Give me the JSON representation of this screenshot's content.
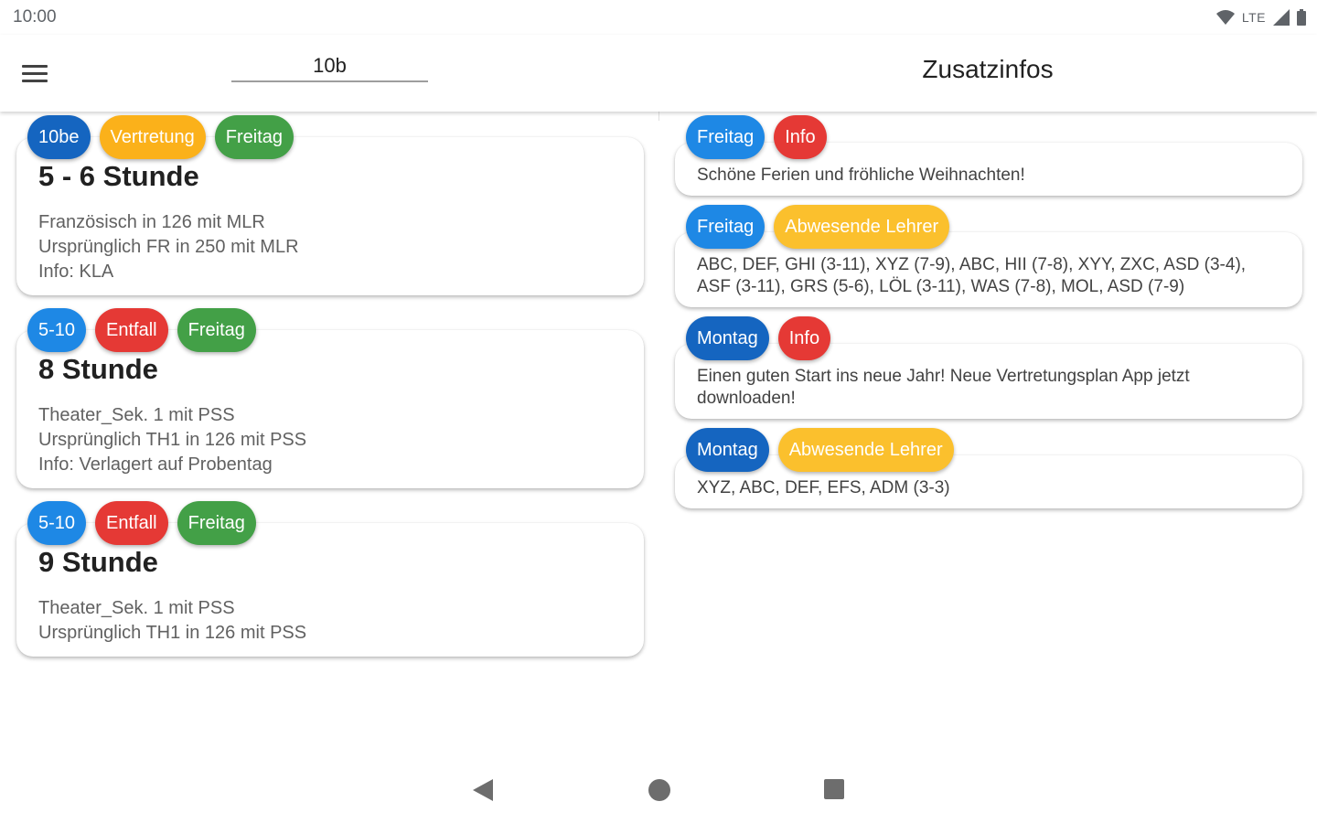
{
  "status_bar": {
    "time": "10:00",
    "network": "LTE"
  },
  "app_bar": {
    "menu_icon": "menu-icon",
    "class_field_value": "10b",
    "info_title": "Zusatzinfos"
  },
  "colors": {
    "blue": "#1e88e5",
    "dark_blue": "#1565c0",
    "orange": "#fbb11a",
    "yellow": "#fbc02d",
    "green": "#43a047",
    "red": "#e53935"
  },
  "lessons": [
    {
      "tags": [
        {
          "label": "10be",
          "color": "#1565c0"
        },
        {
          "label": "Vertretung",
          "color": "#fbb11a"
        },
        {
          "label": "Freitag",
          "color": "#43a047"
        }
      ],
      "title": "5 - 6 Stunde",
      "lines": [
        "Französisch in 126 mit MLR",
        "Ursprünglich FR in 250 mit MLR",
        "Info: KLA"
      ]
    },
    {
      "tags": [
        {
          "label": "5-10",
          "color": "#1e88e5"
        },
        {
          "label": "Entfall",
          "color": "#e53935"
        },
        {
          "label": "Freitag",
          "color": "#43a047"
        }
      ],
      "title": "8 Stunde",
      "lines": [
        "Theater_Sek. 1 mit PSS",
        "Ursprünglich TH1 in 126 mit PSS",
        "Info: Verlagert auf Probentag"
      ]
    },
    {
      "tags": [
        {
          "label": "5-10",
          "color": "#1e88e5"
        },
        {
          "label": "Entfall",
          "color": "#e53935"
        },
        {
          "label": "Freitag",
          "color": "#43a047"
        }
      ],
      "title": "9 Stunde",
      "lines": [
        "Theater_Sek. 1 mit PSS",
        "Ursprünglich TH1 in 126 mit PSS"
      ]
    }
  ],
  "infos": [
    {
      "tags": [
        {
          "label": "Freitag",
          "color": "#1e88e5"
        },
        {
          "label": "Info",
          "color": "#e53935"
        }
      ],
      "text": "Schöne Ferien und fröhliche Weihnachten!"
    },
    {
      "tags": [
        {
          "label": "Freitag",
          "color": "#1e88e5"
        },
        {
          "label": "Abwesende Lehrer",
          "color": "#fbc02d"
        }
      ],
      "text": "ABC, DEF, GHI (3-11), XYZ (7-9), ABC, HII (7-8), XYY, ZXC, ASD (3-4), ASF (3-11), GRS (5-6), LÖL (3-11), WAS (7-8), MOL, ASD (7-9)"
    },
    {
      "tags": [
        {
          "label": "Montag",
          "color": "#1565c0"
        },
        {
          "label": "Info",
          "color": "#e53935"
        }
      ],
      "text": "Einen guten Start ins neue Jahr! Neue Vertretungsplan App jetzt downloaden!"
    },
    {
      "tags": [
        {
          "label": "Montag",
          "color": "#1565c0"
        },
        {
          "label": "Abwesende Lehrer",
          "color": "#fbc02d"
        }
      ],
      "text": "XYZ, ABC, DEF, EFS, ADM (3-3)"
    }
  ]
}
